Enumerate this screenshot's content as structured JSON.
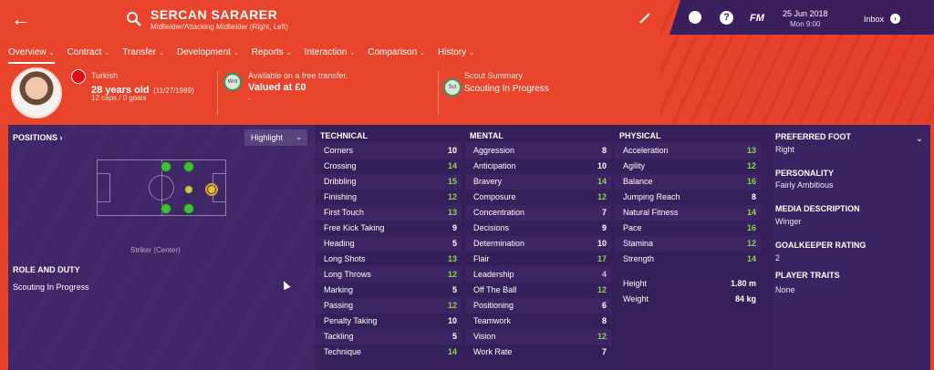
{
  "header": {
    "player_name": "SERCAN SARARER",
    "positions_line": "Midfielder/Attacking Midfielder (Right, Left)"
  },
  "topbar": {
    "date": "25 Jun 2018",
    "time": "Mon 9:00",
    "fm_label": "FM",
    "help_label": "?",
    "inbox_label": "Inbox"
  },
  "tabs": [
    {
      "label": "Overview"
    },
    {
      "label": "Contract"
    },
    {
      "label": "Transfer"
    },
    {
      "label": "Development"
    },
    {
      "label": "Reports"
    },
    {
      "label": "Interaction"
    },
    {
      "label": "Comparison"
    },
    {
      "label": "History"
    }
  ],
  "profile": {
    "nationality": "Turkish",
    "age": "28 years old",
    "dob": "(11/27/1989)",
    "caps": "12 caps / 0 goals"
  },
  "transfer": {
    "badge": "Wnt",
    "status": "Available on a free transfer.",
    "value": "Valued at £0",
    "extra": "-"
  },
  "scout": {
    "badge": "Sct",
    "title": "Scout Summary",
    "status": "Scouting In Progress"
  },
  "positions": {
    "title": "POSITIONS ›",
    "highlight_label": "Highlight",
    "position_label": "Striker (Center)"
  },
  "role": {
    "title": "ROLE AND DUTY",
    "value": "Scouting In Progress"
  },
  "technical": {
    "title": "TECHNICAL",
    "rows": [
      {
        "name": "Corners",
        "value": "10"
      },
      {
        "name": "Crossing",
        "value": "14"
      },
      {
        "name": "Dribbling",
        "value": "15"
      },
      {
        "name": "Finishing",
        "value": "12"
      },
      {
        "name": "First Touch",
        "value": "13"
      },
      {
        "name": "Free Kick Taking",
        "value": "9"
      },
      {
        "name": "Heading",
        "value": "5"
      },
      {
        "name": "Long Shots",
        "value": "13"
      },
      {
        "name": "Long Throws",
        "value": "12"
      },
      {
        "name": "Marking",
        "value": "5"
      },
      {
        "name": "Passing",
        "value": "12"
      },
      {
        "name": "Penalty Taking",
        "value": "10"
      },
      {
        "name": "Tackling",
        "value": "5"
      },
      {
        "name": "Technique",
        "value": "14"
      }
    ]
  },
  "mental": {
    "title": "MENTAL",
    "rows": [
      {
        "name": "Aggression",
        "value": "8"
      },
      {
        "name": "Anticipation",
        "value": "10"
      },
      {
        "name": "Bravery",
        "value": "14"
      },
      {
        "name": "Composure",
        "value": "12"
      },
      {
        "name": "Concentration",
        "value": "7"
      },
      {
        "name": "Decisions",
        "value": "9"
      },
      {
        "name": "Determination",
        "value": "10"
      },
      {
        "name": "Flair",
        "value": "17"
      },
      {
        "name": "Leadership",
        "value": "4"
      },
      {
        "name": "Off The Ball",
        "value": "12"
      },
      {
        "name": "Positioning",
        "value": "6"
      },
      {
        "name": "Teamwork",
        "value": "8"
      },
      {
        "name": "Vision",
        "value": "12"
      },
      {
        "name": "Work Rate",
        "value": "7"
      }
    ]
  },
  "physical": {
    "title": "PHYSICAL",
    "rows": [
      {
        "name": "Acceleration",
        "value": "13"
      },
      {
        "name": "Agility",
        "value": "12"
      },
      {
        "name": "Balance",
        "value": "16"
      },
      {
        "name": "Jumping Reach",
        "value": "8"
      },
      {
        "name": "Natural Fitness",
        "value": "14"
      },
      {
        "name": "Pace",
        "value": "16"
      },
      {
        "name": "Stamina",
        "value": "12"
      },
      {
        "name": "Strength",
        "value": "14"
      }
    ],
    "height_label": "Height",
    "height_value": "1.80 m",
    "weight_label": "Weight",
    "weight_value": "84 kg"
  },
  "right_panel": {
    "preferred_foot_title": "PREFERRED FOOT",
    "preferred_foot": "Right",
    "personality_title": "PERSONALITY",
    "personality": "Fairly Ambitious",
    "media_title": "MEDIA DESCRIPTION",
    "media": "Winger",
    "gk_title": "GOALKEEPER RATING",
    "gk": "2",
    "traits_title": "PLAYER TRAITS",
    "traits": "None"
  },
  "colors": {
    "header_orange": "#e8432b",
    "panel_purple": "#3b2462",
    "attr_green": "#8fd24f"
  }
}
